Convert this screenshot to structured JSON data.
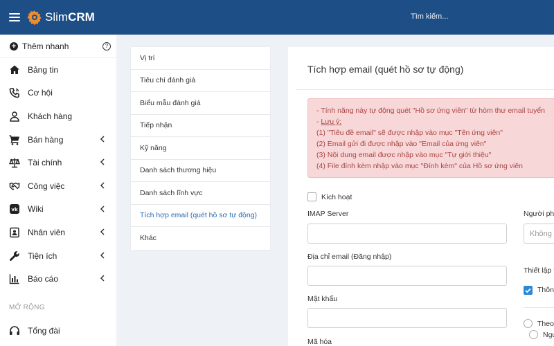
{
  "app": {
    "brand_light": "Slim",
    "brand_bold": "CRM"
  },
  "header": {
    "search_placeholder": "Tìm kiếm..."
  },
  "sidebar": {
    "quick_add": "Thêm nhanh",
    "items": [
      {
        "label": "Bảng tin",
        "icon": "home-icon",
        "has_submenu": false
      },
      {
        "label": "Cơ hội",
        "icon": "phone-icon",
        "has_submenu": false
      },
      {
        "label": "Khách hàng",
        "icon": "user-icon",
        "has_submenu": false
      },
      {
        "label": "Bán hàng",
        "icon": "cart-icon",
        "has_submenu": true
      },
      {
        "label": "Tài chính",
        "icon": "scale-icon",
        "has_submenu": true
      },
      {
        "label": "Công việc",
        "icon": "handshake-icon",
        "has_submenu": true
      },
      {
        "label": "Wiki",
        "icon": "vk-icon",
        "has_submenu": true
      },
      {
        "label": "Nhân viên",
        "icon": "id-card-icon",
        "has_submenu": true
      },
      {
        "label": "Tiện ích",
        "icon": "wrench-icon",
        "has_submenu": true
      },
      {
        "label": "Báo cáo",
        "icon": "bar-chart-icon",
        "has_submenu": true
      }
    ],
    "section_label": "MỞ RỘNG",
    "extra_items": [
      {
        "label": "Tổng đài",
        "icon": "headset-icon"
      }
    ]
  },
  "settings_menu": {
    "items": [
      "Vị trí",
      "Tiêu chí đánh giá",
      "Biểu mẫu đánh giá",
      "Tiếp nhận",
      "Kỹ năng",
      "Danh sách thương hiệu",
      "Danh sách lĩnh vực",
      "Tích hợp email (quét hồ sơ tự động)",
      "Khác"
    ],
    "active_index": 7
  },
  "panel": {
    "title": "Tích hợp email (quét hồ sơ tự động)",
    "alert": {
      "line1": "- Tính năng này tự động quét \"Hồ sơ ứng viên\" từ hòm thư email tuyển",
      "line2_prefix": "- ",
      "line2_link": "Lưu ý:",
      "line3": "(1) \"Tiêu đề email\" sẽ được nhập vào mục \"Tên ứng viên\"",
      "line4": "(2) Email gửi đi được nhập vào \"Email của ứng viên\"",
      "line5": "(3) Nội dung email được nhập vào mục \"Tự giới thiệu\"",
      "line6": "(4) File đính kèm nhập vào mục \"Đính kèm\" của Hồ sơ ứng viên"
    },
    "activate_label": "Kích hoạt",
    "activate_checked": false,
    "imap_label": "IMAP Server",
    "imap_value": "",
    "email_label": "Địa chỉ email (Đăng nhập)",
    "email_value": "",
    "password_label": "Mật khẩu",
    "password_value": "",
    "encryption_label": "Mã hóa",
    "right_col": {
      "handler_label": "Người phụ",
      "handler_placeholder": "Không",
      "settings_label": "Thiết lập t",
      "notify_label": "Thông",
      "notify_checked": true,
      "radio1_label": "Theo",
      "radio2_label": "Ngư"
    }
  },
  "colors": {
    "header_bg": "#1e4e86",
    "active_menu": "#2a6bb3",
    "alert_bg": "#f8d7d8",
    "alert_text": "#a94442",
    "checkbox_checked": "#2b8ad8"
  }
}
